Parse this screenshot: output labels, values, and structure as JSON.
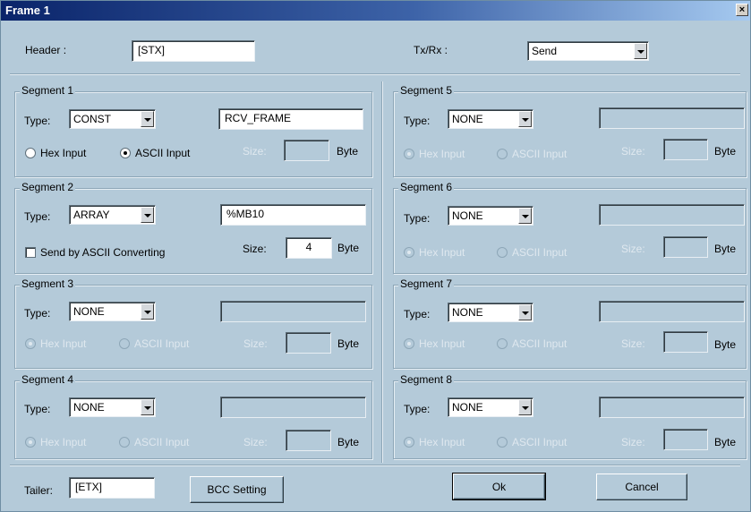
{
  "window": {
    "title": "Frame 1",
    "close_glyph": "×"
  },
  "header": {
    "label": "Header :",
    "value": "[STX]"
  },
  "txrx": {
    "label": "Tx/Rx :",
    "value": "Send"
  },
  "common": {
    "type_label": "Type:",
    "size_label": "Size:",
    "byte_label": "Byte",
    "hex_input": "Hex Input",
    "ascii_input": "ASCII Input"
  },
  "segments": [
    {
      "title": "Segment 1",
      "type": "CONST",
      "value": "RCV_FRAME",
      "enabled": true,
      "input_mode": "ASCII Input",
      "size": ""
    },
    {
      "title": "Segment 2",
      "type": "ARRAY",
      "value": "%MB10",
      "enabled": true,
      "send_ascii_label": "Send by ASCII Converting",
      "send_ascii_checked": false,
      "size": "4"
    },
    {
      "title": "Segment 3",
      "type": "NONE",
      "value": "",
      "enabled": false,
      "input_mode": "Hex Input",
      "size": ""
    },
    {
      "title": "Segment 4",
      "type": "NONE",
      "value": "",
      "enabled": false,
      "input_mode": "Hex Input",
      "size": ""
    },
    {
      "title": "Segment 5",
      "type": "NONE",
      "value": "",
      "enabled": false,
      "input_mode": "Hex Input",
      "size": ""
    },
    {
      "title": "Segment 6",
      "type": "NONE",
      "value": "",
      "enabled": false,
      "input_mode": "Hex Input",
      "size": ""
    },
    {
      "title": "Segment 7",
      "type": "NONE",
      "value": "",
      "enabled": false,
      "input_mode": "Hex Input",
      "size": ""
    },
    {
      "title": "Segment 8",
      "type": "NONE",
      "value": "",
      "enabled": false,
      "input_mode": "Hex Input",
      "size": ""
    }
  ],
  "tailer": {
    "label": "Tailer:",
    "value": "[ETX]"
  },
  "buttons": {
    "bcc": "BCC Setting",
    "ok": "Ok",
    "cancel": "Cancel"
  },
  "colors": {
    "dialog_bg": "#b4cad9",
    "title_bar": "#0a246a"
  }
}
